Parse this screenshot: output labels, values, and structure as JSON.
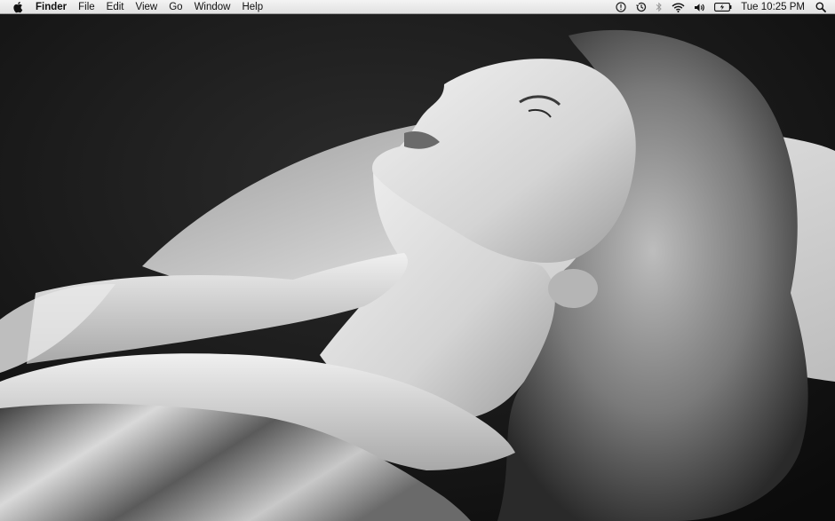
{
  "menubar": {
    "apple_icon": "apple-icon",
    "app_name": "Finder",
    "menus": [
      "File",
      "Edit",
      "View",
      "Go",
      "Window",
      "Help"
    ],
    "status_icons": [
      "alert-icon",
      "time-machine-icon",
      "bluetooth-icon",
      "wifi-icon",
      "volume-icon",
      "battery-icon"
    ],
    "clock": "Tue 10:25 PM",
    "spotlight_icon": "spotlight-search-icon"
  },
  "desktop": {
    "wallpaper": "black-and-white portrait of a woman in a satin ruffled gown"
  }
}
